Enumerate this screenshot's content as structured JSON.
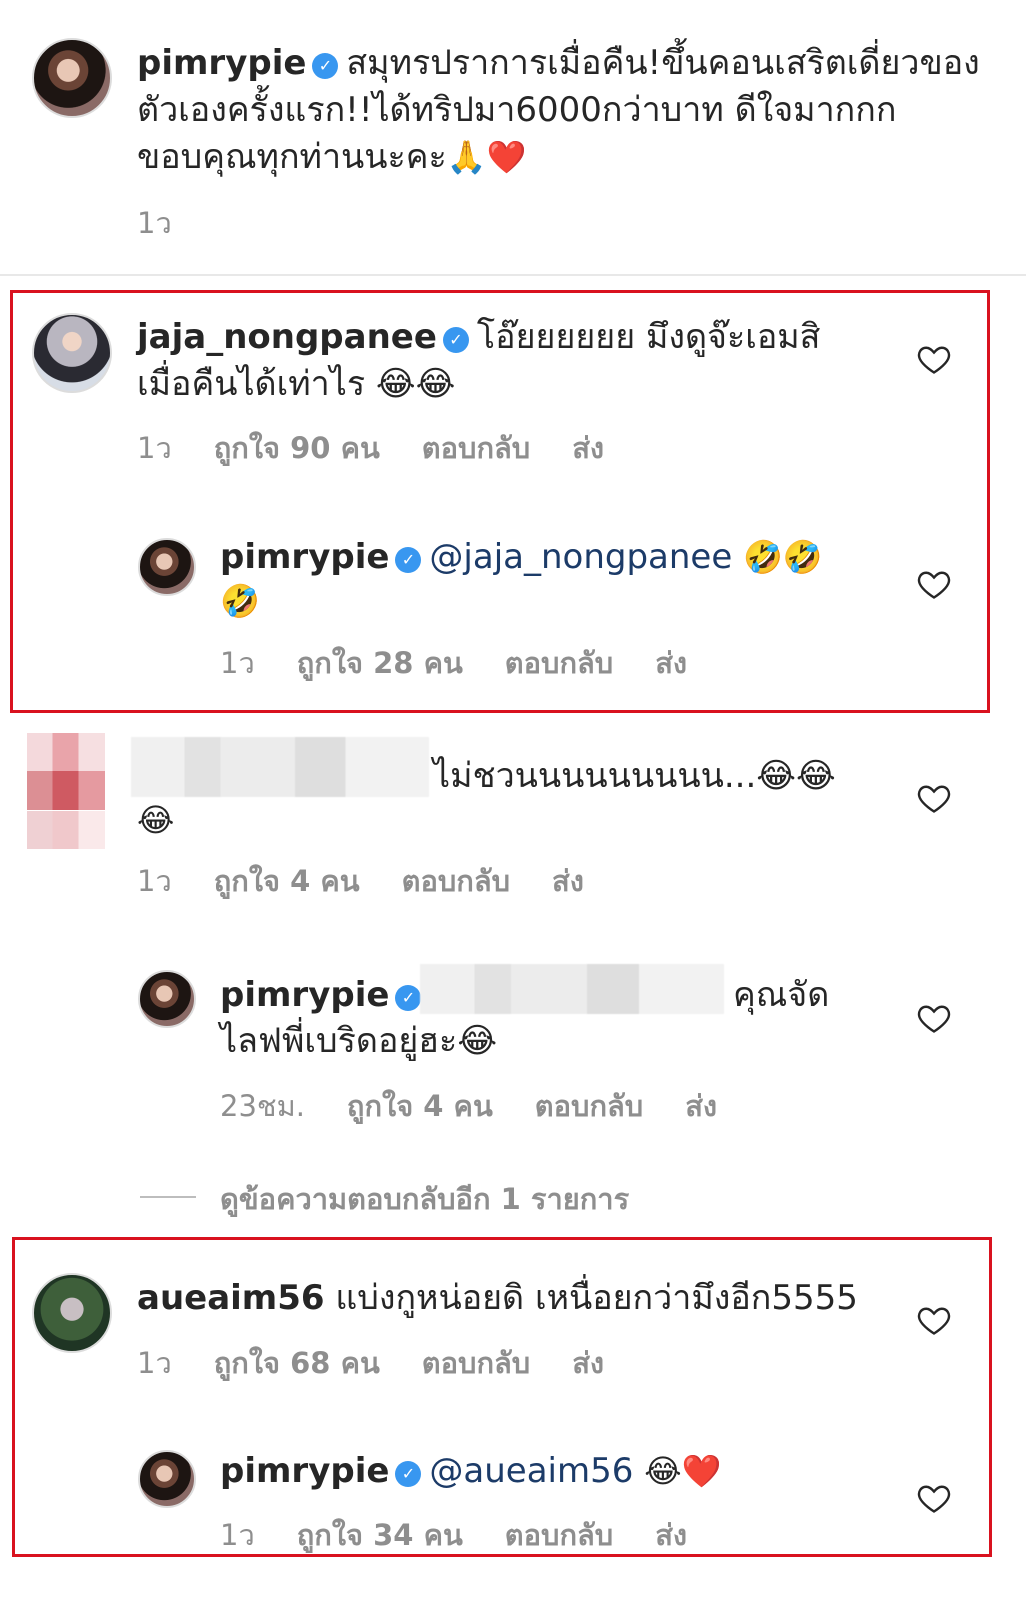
{
  "post": {
    "username": "pimrypie",
    "caption_line1": "สมุทรปราการเมื่อคืน!ขึ้นคอนเสริตเดี่ยวของ",
    "caption_line2": "ตัวเองครั้งแรก!!ได้ทริปมา6000กว่าบาท ดีใจมากกก",
    "caption_line3": "ขอบคุณทุกท่านนะคะ",
    "emoji_pray": "🙏",
    "emoji_heart": "❤️",
    "time": "1ว"
  },
  "comments": [
    {
      "username": "jaja_nongpanee",
      "text_line1": "โอ๊ยยยยยย มึงดูจ๊ะเอมสิ",
      "text_line2": "เมื่อคืนได้เท่าไร 😂😂",
      "time": "1ว",
      "likes": "ถูกใจ 90 คน",
      "reply": "ตอบกลับ",
      "send": "ส่ง",
      "reply_item": {
        "username": "pimrypie",
        "mention": "@jaja_nongpanee",
        "emoji_line1": "🤣🤣",
        "emoji_line2": "🤣",
        "time": "1ว",
        "likes": "ถูกใจ 28 คน",
        "reply": "ตอบกลับ",
        "send": "ส่ง"
      }
    },
    {
      "text_line1": "ไม่ชวนนนนนนนนน...😂😂",
      "text_line2": "😂",
      "time": "1ว",
      "likes": "ถูกใจ 4 คน",
      "reply": "ตอบกลับ",
      "send": "ส่ง",
      "reply_item": {
        "username": "pimrypie",
        "text_line1_end": "คุณจัด",
        "text_line2": "ไลฟพี่เบริดอยู่ฮะ😂",
        "time": "23ชม.",
        "likes": "ถูกใจ 4 คน",
        "reply": "ตอบกลับ",
        "send": "ส่ง"
      },
      "view_more": "ดูข้อความตอบกลับอีก 1 รายการ"
    },
    {
      "username": "aueaim56",
      "text_line1": "แบ่งกูหน่อยดิ เหนื่อยกว่ามึงอีก5555",
      "time": "1ว",
      "likes": "ถูกใจ 68 คน",
      "reply": "ตอบกลับ",
      "send": "ส่ง",
      "reply_item": {
        "username": "pimrypie",
        "mention": "@aueaim56",
        "emoji": "😂❤️",
        "time": "1ว",
        "likes": "ถูกใจ 34 คน",
        "reply": "ตอบกลับ",
        "send": "ส่ง"
      }
    }
  ],
  "verified_glyph": "✓",
  "icons": {
    "like": "heart-outline-icon",
    "verified": "verified-badge-icon"
  },
  "colors": {
    "highlight_box": "#d9121f",
    "verified": "#3897f0",
    "meta_text": "#8e8e8e"
  }
}
